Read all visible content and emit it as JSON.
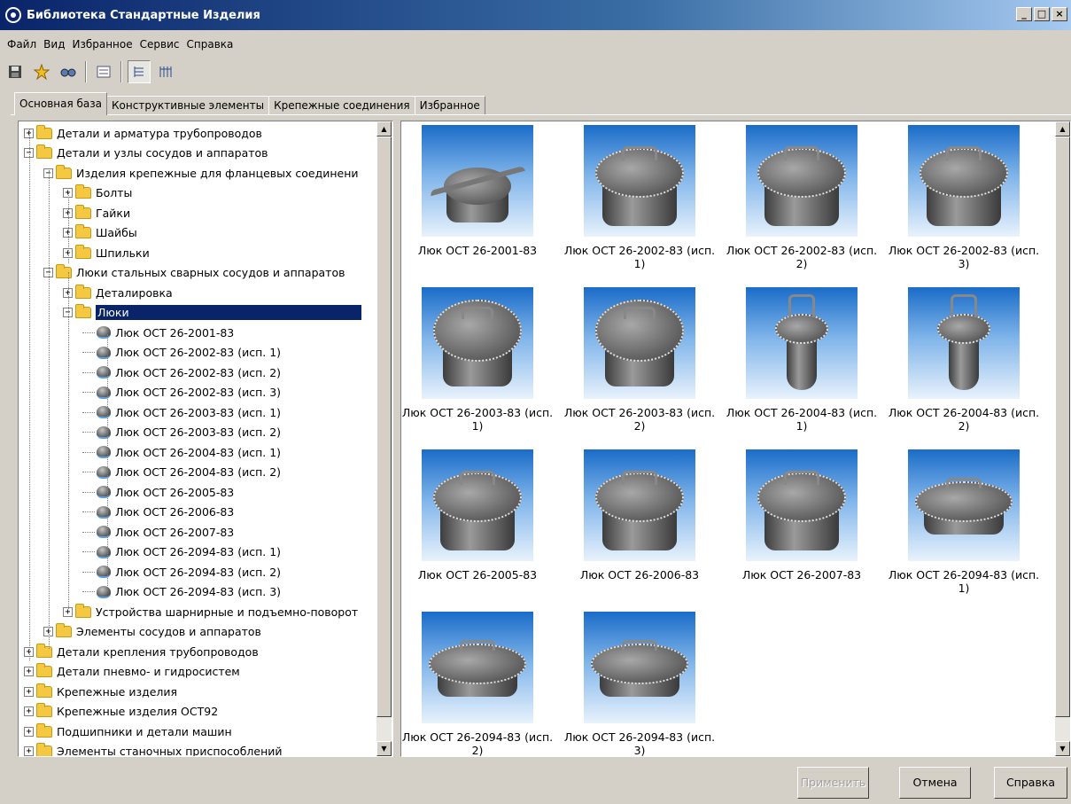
{
  "window": {
    "title": "Библиотека Стандартные Изделия",
    "min": "_",
    "max": "□",
    "close": "×"
  },
  "menu": [
    "Файл",
    "Вид",
    "Избранное",
    "Сервис",
    "Справка"
  ],
  "tabs": [
    "Основная база",
    "Конструктивные элементы",
    "Крепежные соединения",
    "Избранное"
  ],
  "tree": [
    {
      "label": "Детали и арматура трубопроводов",
      "level": 0,
      "exp": "+",
      "kind": "folder"
    },
    {
      "label": "Детали и узлы сосудов и аппаратов",
      "level": 0,
      "exp": "−",
      "kind": "folder"
    },
    {
      "label": "Изделия крепежные для фланцевых соединени",
      "level": 1,
      "exp": "−",
      "kind": "folder"
    },
    {
      "label": "Болты",
      "level": 2,
      "exp": "+",
      "kind": "folder"
    },
    {
      "label": "Гайки",
      "level": 2,
      "exp": "+",
      "kind": "folder"
    },
    {
      "label": "Шайбы",
      "level": 2,
      "exp": "+",
      "kind": "folder"
    },
    {
      "label": "Шпильки",
      "level": 2,
      "exp": "+",
      "kind": "folder"
    },
    {
      "label": "Люки стальных сварных сосудов и аппаратов",
      "level": 1,
      "exp": "−",
      "kind": "folder"
    },
    {
      "label": "Деталировка",
      "level": 2,
      "exp": "+",
      "kind": "folder"
    },
    {
      "label": "Люки",
      "level": 2,
      "exp": "−",
      "kind": "folder",
      "selected": true
    },
    {
      "label": "Люк ОСТ 26-2001-83",
      "level": 3,
      "kind": "leaf"
    },
    {
      "label": "Люк ОСТ 26-2002-83 (исп. 1)",
      "level": 3,
      "kind": "leaf"
    },
    {
      "label": "Люк ОСТ 26-2002-83 (исп. 2)",
      "level": 3,
      "kind": "leaf"
    },
    {
      "label": "Люк ОСТ 26-2002-83 (исп. 3)",
      "level": 3,
      "kind": "leaf"
    },
    {
      "label": "Люк ОСТ 26-2003-83 (исп. 1)",
      "level": 3,
      "kind": "leaf"
    },
    {
      "label": "Люк ОСТ 26-2003-83 (исп. 2)",
      "level": 3,
      "kind": "leaf"
    },
    {
      "label": "Люк ОСТ 26-2004-83 (исп. 1)",
      "level": 3,
      "kind": "leaf"
    },
    {
      "label": "Люк ОСТ 26-2004-83 (исп. 2)",
      "level": 3,
      "kind": "leaf"
    },
    {
      "label": "Люк ОСТ 26-2005-83",
      "level": 3,
      "kind": "leaf"
    },
    {
      "label": "Люк ОСТ 26-2006-83",
      "level": 3,
      "kind": "leaf"
    },
    {
      "label": "Люк ОСТ 26-2007-83",
      "level": 3,
      "kind": "leaf"
    },
    {
      "label": "Люк ОСТ 26-2094-83 (исп. 1)",
      "level": 3,
      "kind": "leaf"
    },
    {
      "label": "Люк ОСТ 26-2094-83 (исп. 2)",
      "level": 3,
      "kind": "leaf"
    },
    {
      "label": "Люк ОСТ 26-2094-83 (исп. 3)",
      "level": 3,
      "kind": "leaf"
    },
    {
      "label": "Устройства шарнирные и подъемно-поворот",
      "level": 2,
      "exp": "+",
      "kind": "folder"
    },
    {
      "label": "Элементы сосудов и аппаратов",
      "level": 1,
      "exp": "+",
      "kind": "folder"
    },
    {
      "label": "Детали крепления трубопроводов",
      "level": 0,
      "exp": "+",
      "kind": "folder"
    },
    {
      "label": "Детали пневмо- и гидросистем",
      "level": 0,
      "exp": "+",
      "kind": "folder"
    },
    {
      "label": "Крепежные изделия",
      "level": 0,
      "exp": "+",
      "kind": "folder"
    },
    {
      "label": "Крепежные изделия ОСТ92",
      "level": 0,
      "exp": "+",
      "kind": "folder"
    },
    {
      "label": "Подшипники и детали машин",
      "level": 0,
      "exp": "+",
      "kind": "folder"
    },
    {
      "label": "Элементы станочных приспособлений",
      "level": 0,
      "exp": "+",
      "kind": "folder"
    }
  ],
  "gallery": [
    {
      "caption": "Люк ОСТ 26-2001-83",
      "style": "a"
    },
    {
      "caption": "Люк ОСТ 26-2002-83 (исп.\n1)",
      "style": "b"
    },
    {
      "caption": "Люк ОСТ 26-2002-83 (исп.\n2)",
      "style": "b"
    },
    {
      "caption": "Люк ОСТ 26-2002-83 (исп.\n3)",
      "style": "b"
    },
    {
      "caption": "Люк ОСТ 26-2003-83 (исп.\n1)",
      "style": "c"
    },
    {
      "caption": "Люк ОСТ 26-2003-83 (исп.\n2)",
      "style": "c"
    },
    {
      "caption": "Люк ОСТ 26-2004-83 (исп.\n1)",
      "style": "d"
    },
    {
      "caption": "Люк ОСТ 26-2004-83 (исп.\n2)",
      "style": "d"
    },
    {
      "caption": "Люк ОСТ 26-2005-83",
      "style": "b"
    },
    {
      "caption": "Люк ОСТ 26-2006-83",
      "style": "b"
    },
    {
      "caption": "Люк ОСТ 26-2007-83",
      "style": "b"
    },
    {
      "caption": "Люк ОСТ 26-2094-83 (исп.\n1)",
      "style": "e"
    },
    {
      "caption": "Люк ОСТ 26-2094-83 (исп.\n2)",
      "style": "e"
    },
    {
      "caption": "Люк ОСТ 26-2094-83 (исп.\n3)",
      "style": "e"
    }
  ],
  "buttons": {
    "apply": "Применить",
    "cancel": "Отмена",
    "help": "Справка"
  }
}
